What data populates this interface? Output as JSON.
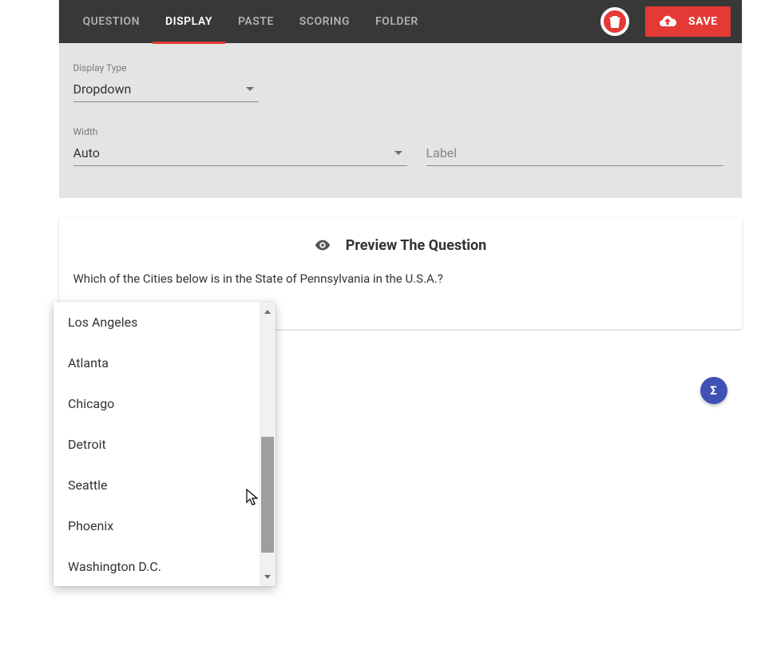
{
  "colors": {
    "accent": "#e53935",
    "sigma": "#3f51b5"
  },
  "tabs": [
    {
      "label": "QUESTION",
      "active": false
    },
    {
      "label": "DISPLAY",
      "active": true
    },
    {
      "label": "PASTE",
      "active": false
    },
    {
      "label": "SCORING",
      "active": false
    },
    {
      "label": "FOLDER",
      "active": false
    }
  ],
  "save_label": "SAVE",
  "displayType": {
    "label": "Display Type",
    "value": "Dropdown"
  },
  "width": {
    "label": "Width",
    "value": "Auto"
  },
  "label_input": {
    "placeholder": "Label",
    "value": ""
  },
  "preview_title": "Preview The Question",
  "question_text": "Which of the Cities below is in the State of Pennsylvania in the U.S.A.?",
  "sigma_label": "Σ",
  "dropdown_options": [
    "Los Angeles",
    "Atlanta",
    "Chicago",
    "Detroit",
    "Seattle",
    "Phoenix",
    "Washington D.C."
  ]
}
